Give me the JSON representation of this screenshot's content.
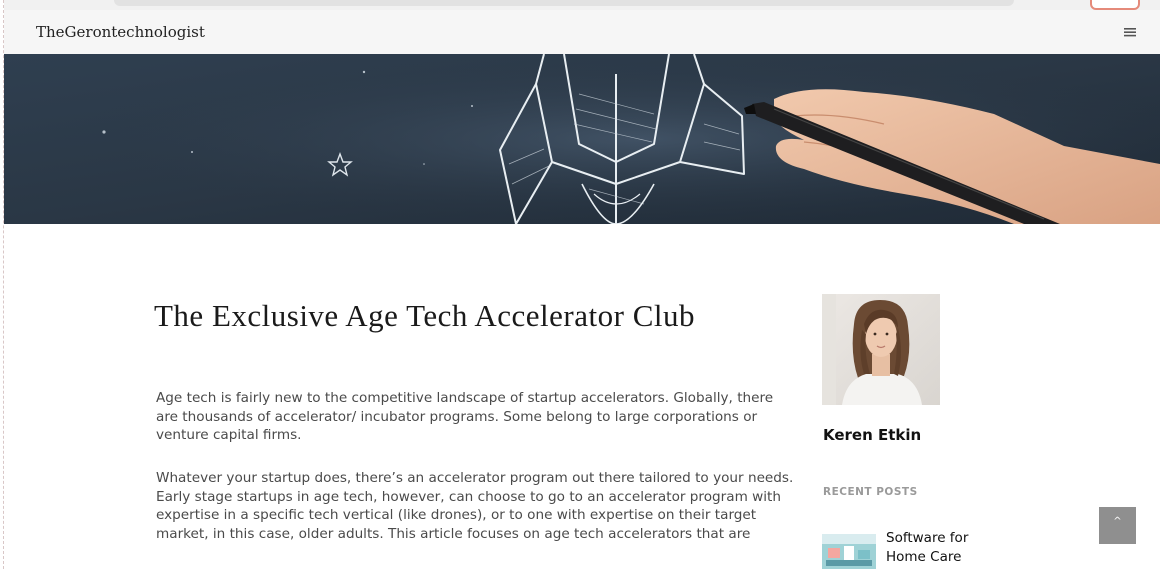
{
  "site": {
    "brand": "TheGerontechnologist",
    "menu_icon": "hamburger-menu-icon"
  },
  "hero": {
    "image": "rocket-sketch-chalkboard-with-hand-and-marker"
  },
  "article": {
    "title": "The Exclusive Age Tech Accelerator Club",
    "paragraphs": [
      "Age tech is fairly new to the competitive landscape of startup accelerators. Globally, there are thousands of accelerator/ incubator programs. Some belong to large corporations or venture capital firms.",
      "Whatever your startup does, there’s an accelerator program out there tailored to your needs. Early stage startups in age tech, however, can choose to go to an accelerator program with expertise in a specific tech vertical (like drones), or to one with expertise on their target market, in this case, older adults. This article focuses on age tech accelerators that are"
    ]
  },
  "sidebar": {
    "author_name": "Keren Etkin",
    "recent_posts_heading": "RECENT POSTS",
    "recent_posts": [
      {
        "title": "Software for Home Care"
      }
    ]
  },
  "scroll_top": {
    "label": "^"
  },
  "colors": {
    "navbar_bg": "#f6f6f6",
    "hero_bg": "#2b3a4a",
    "scroll_button": "#8f8f8f"
  }
}
